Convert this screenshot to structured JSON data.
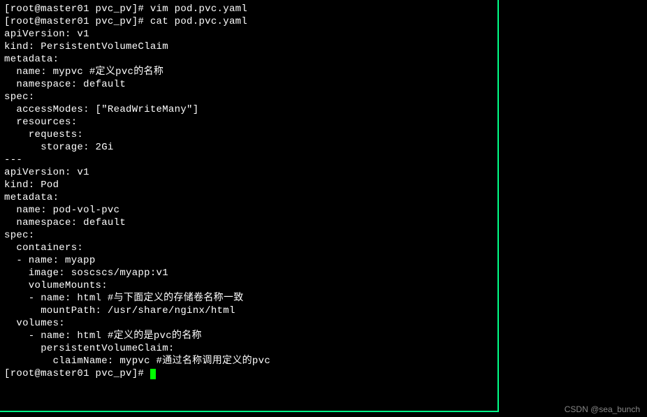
{
  "prompt_prefix": "[root@master01 pvc_pv]# ",
  "commands": {
    "line1": "vim pod.pvc.yaml",
    "line2": "cat pod.pvc.yaml"
  },
  "yaml": {
    "l01": "apiVersion: v1",
    "l02": "kind: PersistentVolumeClaim",
    "l03": "metadata:",
    "l04": "  name: mypvc #定义pvc的名称",
    "l05": "  namespace: default",
    "l06": "spec:",
    "l07": "  accessModes: [\"ReadWriteMany\"]",
    "l08": "  resources:",
    "l09": "    requests:",
    "l10": "      storage: 2Gi",
    "l11": "---",
    "l12": "apiVersion: v1",
    "l13": "kind: Pod",
    "l14": "metadata:",
    "l15": "  name: pod-vol-pvc",
    "l16": "  namespace: default",
    "l17": "spec:",
    "l18": "  containers:",
    "l19": "  - name: myapp",
    "l20": "    image: soscscs/myapp:v1",
    "l21": "    volumeMounts:",
    "l22": "    - name: html #与下面定义的存储卷名称一致",
    "l23": "      mountPath: /usr/share/nginx/html",
    "l24": "  volumes:",
    "l25": "    - name: html #定义的是pvc的名称",
    "l26": "      persistentVolumeClaim:",
    "l27": "        claimName: mypvc #通过名称调用定义的pvc"
  },
  "watermark": "CSDN @sea_bunch"
}
